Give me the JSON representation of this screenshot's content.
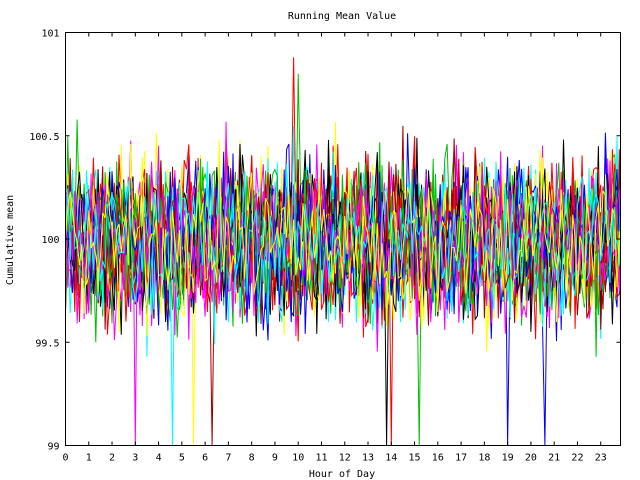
{
  "chart_data": {
    "type": "line",
    "title": "Running Mean Value",
    "xlabel": "Hour of Day",
    "ylabel": "Cumulative mean",
    "xlim": [
      0,
      23.85
    ],
    "ylim": [
      99,
      101
    ],
    "x_ticks": [
      0,
      1,
      2,
      3,
      4,
      5,
      6,
      7,
      8,
      9,
      10,
      11,
      12,
      13,
      14,
      15,
      16,
      17,
      18,
      19,
      20,
      21,
      22,
      23
    ],
    "x_tick_labels": [
      "0",
      "1",
      "2",
      "3",
      "4",
      "5",
      "6",
      "7",
      "8",
      "9",
      "10",
      "11",
      "12",
      "13",
      "14",
      "15",
      "16",
      "17",
      "18",
      "19",
      "20",
      "21",
      "22",
      "23"
    ],
    "y_ticks": [
      99,
      99.5,
      100,
      100.5,
      101
    ],
    "y_tick_labels": [
      "99",
      "99.5",
      "100",
      "100.5",
      "101"
    ],
    "grid": false,
    "legend": "none",
    "series_colors": [
      "#ff0000",
      "#00c000",
      "#0000ff",
      "#ff00ff",
      "#00ffff",
      "#ffff00",
      "#a00000",
      "#000000"
    ],
    "series_count": 30,
    "points_per_series": 240,
    "x_step": 0.1,
    "value_center": 100.0,
    "value_spread": 0.18,
    "value_min_observed": 99.0,
    "value_max_observed": 100.88,
    "notable_spikes": [
      {
        "x": 9.8,
        "y": 100.88
      },
      {
        "x": 10.0,
        "y": 100.8
      },
      {
        "x": 20.6,
        "y": 99.0
      },
      {
        "x": 3.0,
        "y": 99.0
      },
      {
        "x": 4.6,
        "y": 99.0
      },
      {
        "x": 5.5,
        "y": 99.0
      },
      {
        "x": 6.3,
        "y": 99.0
      },
      {
        "x": 13.8,
        "y": 99.0
      },
      {
        "x": 14.0,
        "y": 99.0
      },
      {
        "x": 15.2,
        "y": 99.0
      },
      {
        "x": 19.0,
        "y": 99.0
      }
    ]
  }
}
